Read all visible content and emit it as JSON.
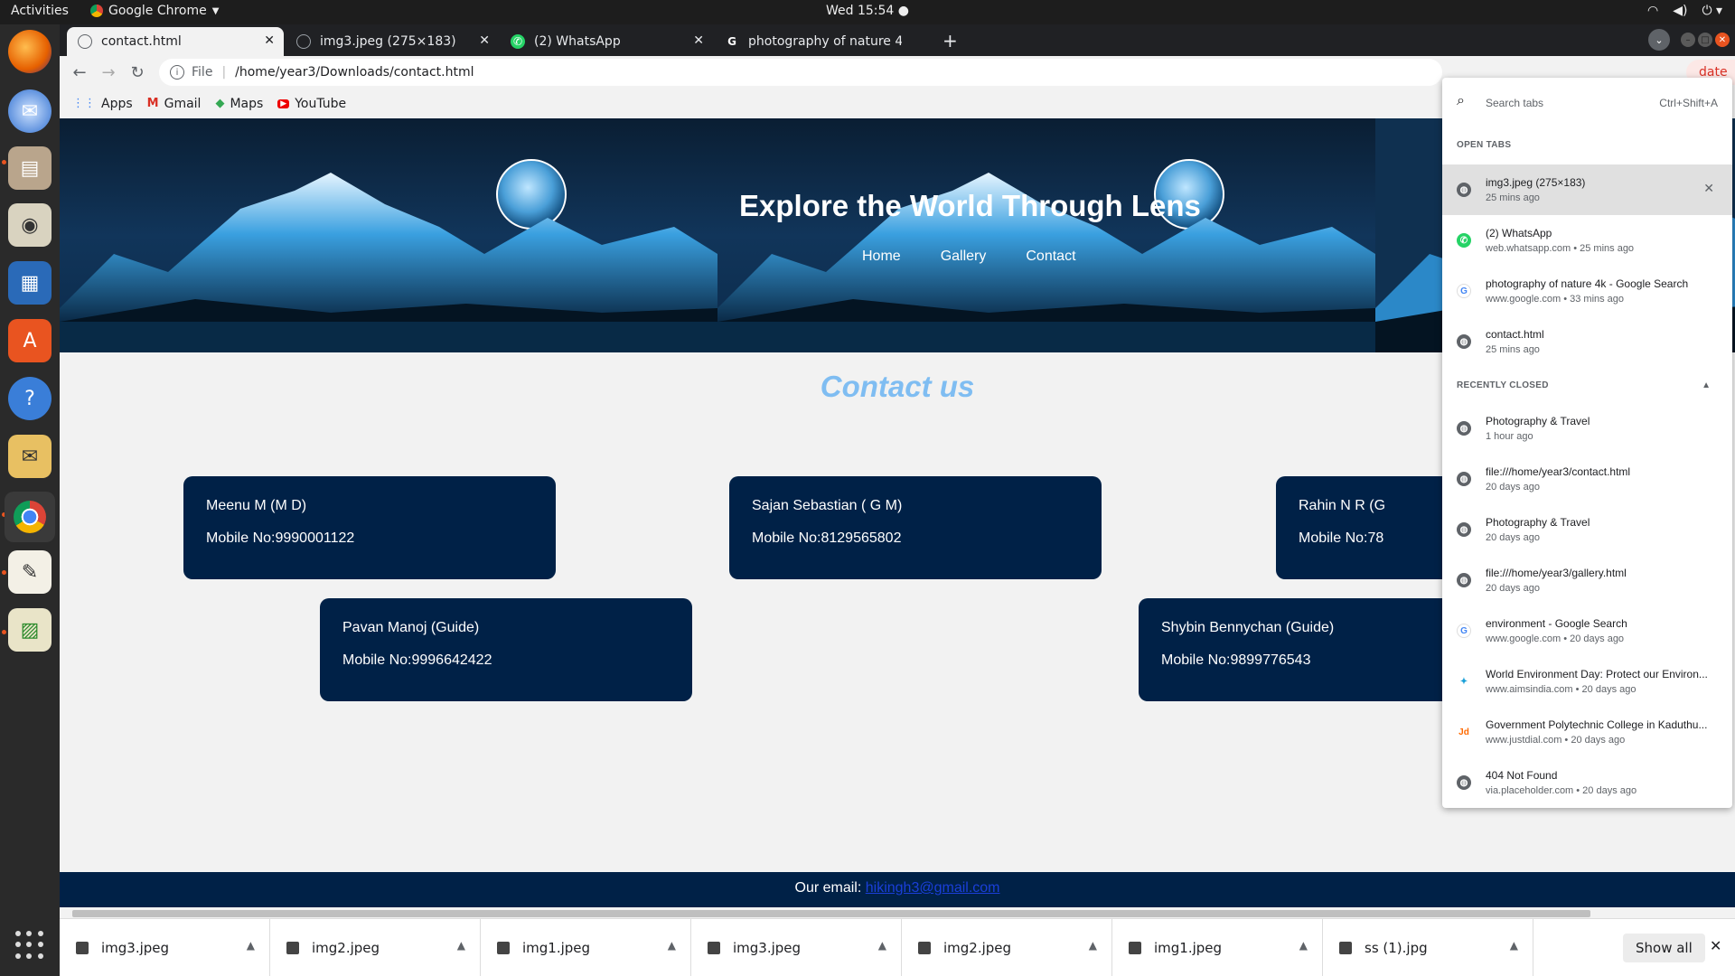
{
  "topbar": {
    "activities": "Activities",
    "app_name": "Google Chrome",
    "clock": "Wed 15:54 ●"
  },
  "dock": {
    "apps": [
      "firefox-icon",
      "thunderbird-icon",
      "files-icon",
      "rhythmbox-icon",
      "writer-icon",
      "software-icon",
      "help-icon",
      "mail-search-icon",
      "chrome-icon",
      "text-editor-icon",
      "image-viewer-icon"
    ]
  },
  "tabs": [
    {
      "title": "contact.html",
      "active": true
    },
    {
      "title": "img3.jpeg (275×183)",
      "active": false
    },
    {
      "title": "(2) WhatsApp",
      "active": false
    },
    {
      "title": "photography of nature 4k",
      "active": false
    }
  ],
  "toolbar": {
    "scheme": "File",
    "url": "/home/year3/Downloads/contact.html",
    "update_label": "date"
  },
  "bookmarks": [
    "Apps",
    "Gmail",
    "Maps",
    "YouTube"
  ],
  "page": {
    "hero_title": "Explore the World Through Lens",
    "nav": [
      "Home",
      "Gallery",
      "Contact"
    ],
    "heading": "Contact us",
    "cards": [
      {
        "name": "Meenu M (M D)",
        "mobile": "Mobile No:9990001122"
      },
      {
        "name": "Sajan Sebastian ( G M)",
        "mobile": "Mobile No:8129565802"
      },
      {
        "name": "Rahin N R (G",
        "mobile": "Mobile No:78"
      },
      {
        "name": "Pavan Manoj (Guide)",
        "mobile": "Mobile No:9996642422"
      },
      {
        "name": "Shybin Bennychan (Guide)",
        "mobile": "Mobile No:9899776543"
      }
    ],
    "footer_label": "Our email:",
    "footer_email": "hikingh3@gmail.com"
  },
  "tab_search": {
    "placeholder": "Search tabs",
    "shortcut": "Ctrl+Shift+A",
    "open_tabs_label": "OPEN TABS",
    "recently_closed_label": "RECENTLY CLOSED",
    "open_tabs": [
      {
        "title": "img3.jpeg (275×183)",
        "sub": "25 mins ago",
        "icon": "globe"
      },
      {
        "title": "(2) WhatsApp",
        "sub": "web.whatsapp.com • 25 mins ago",
        "icon": "wa"
      },
      {
        "title": "photography of nature 4k - Google Search",
        "sub": "www.google.com • 33 mins ago",
        "icon": "g"
      },
      {
        "title": "contact.html",
        "sub": "25 mins ago",
        "icon": "globe"
      }
    ],
    "recently_closed": [
      {
        "title": "Photography & Travel",
        "sub": "1 hour ago",
        "icon": "globe"
      },
      {
        "title": "file:///home/year3/contact.html",
        "sub": "20 days ago",
        "icon": "globe"
      },
      {
        "title": "Photography & Travel",
        "sub": "20 days ago",
        "icon": "globe"
      },
      {
        "title": "file:///home/year3/gallery.html",
        "sub": "20 days ago",
        "icon": "globe"
      },
      {
        "title": "environment - Google Search",
        "sub": "www.google.com • 20 days ago",
        "icon": "g"
      },
      {
        "title": "World Environment Day: Protect our Environ...",
        "sub": "www.aimsindia.com • 20 days ago",
        "icon": "aims"
      },
      {
        "title": "Government Polytechnic College in Kaduthu...",
        "sub": "www.justdial.com • 20 days ago",
        "icon": "jd"
      },
      {
        "title": "404 Not Found",
        "sub": "via.placeholder.com • 20 days ago",
        "icon": "globe"
      }
    ]
  },
  "downloads": {
    "files": [
      "img3.jpeg",
      "img2.jpeg",
      "img1.jpeg",
      "img3.jpeg",
      "img2.jpeg",
      "img1.jpeg",
      "ss (1).jpg"
    ],
    "show_all": "Show all"
  }
}
